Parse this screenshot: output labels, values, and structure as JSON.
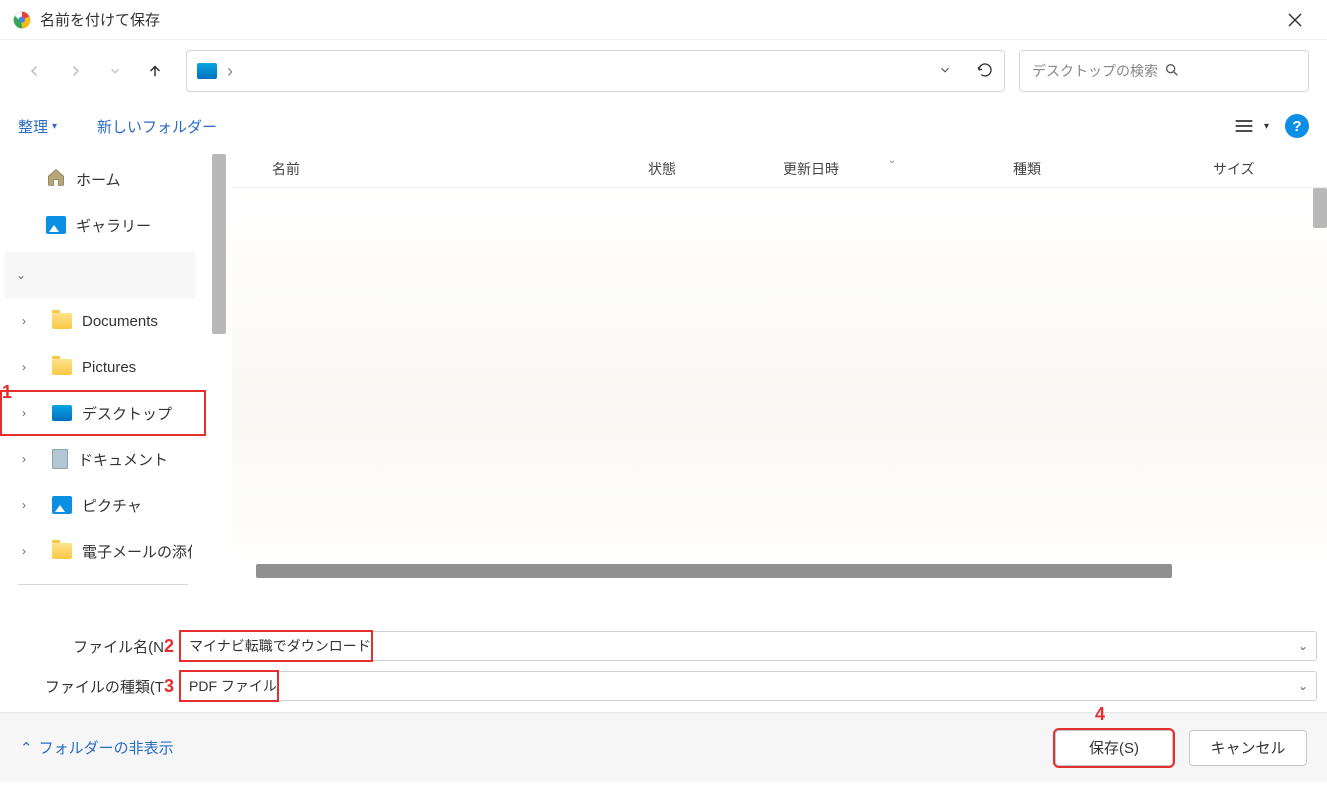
{
  "window": {
    "title": "名前を付けて保存"
  },
  "nav": {
    "path_icon": "desktop",
    "path_sep": "›"
  },
  "search": {
    "placeholder": "デスクトップの検索"
  },
  "toolbar": {
    "organize": "整理",
    "new_folder": "新しいフォルダー"
  },
  "sidebar": {
    "home": "ホーム",
    "gallery": "ギャラリー",
    "items": [
      {
        "label": "Documents"
      },
      {
        "label": "Pictures"
      },
      {
        "label": "デスクトップ"
      },
      {
        "label": "ドキュメント"
      },
      {
        "label": "ピクチャ"
      },
      {
        "label": "電子メールの添付"
      }
    ]
  },
  "columns": {
    "name": "名前",
    "state": "状態",
    "date": "更新日時",
    "type": "種類",
    "size": "サイズ"
  },
  "form": {
    "filename_label": "ファイル名(N",
    "filename_value": "マイナビ転職でダウンロード",
    "filetype_label": "ファイルの種類(T",
    "filetype_value": "PDF ファイル"
  },
  "footer": {
    "hide_folders": "フォルダーの非表示",
    "save": "保存(S)",
    "cancel": "キャンセル"
  },
  "annotations": {
    "a1": "1",
    "a2": "2",
    "a3": "3",
    "a4": "4"
  }
}
